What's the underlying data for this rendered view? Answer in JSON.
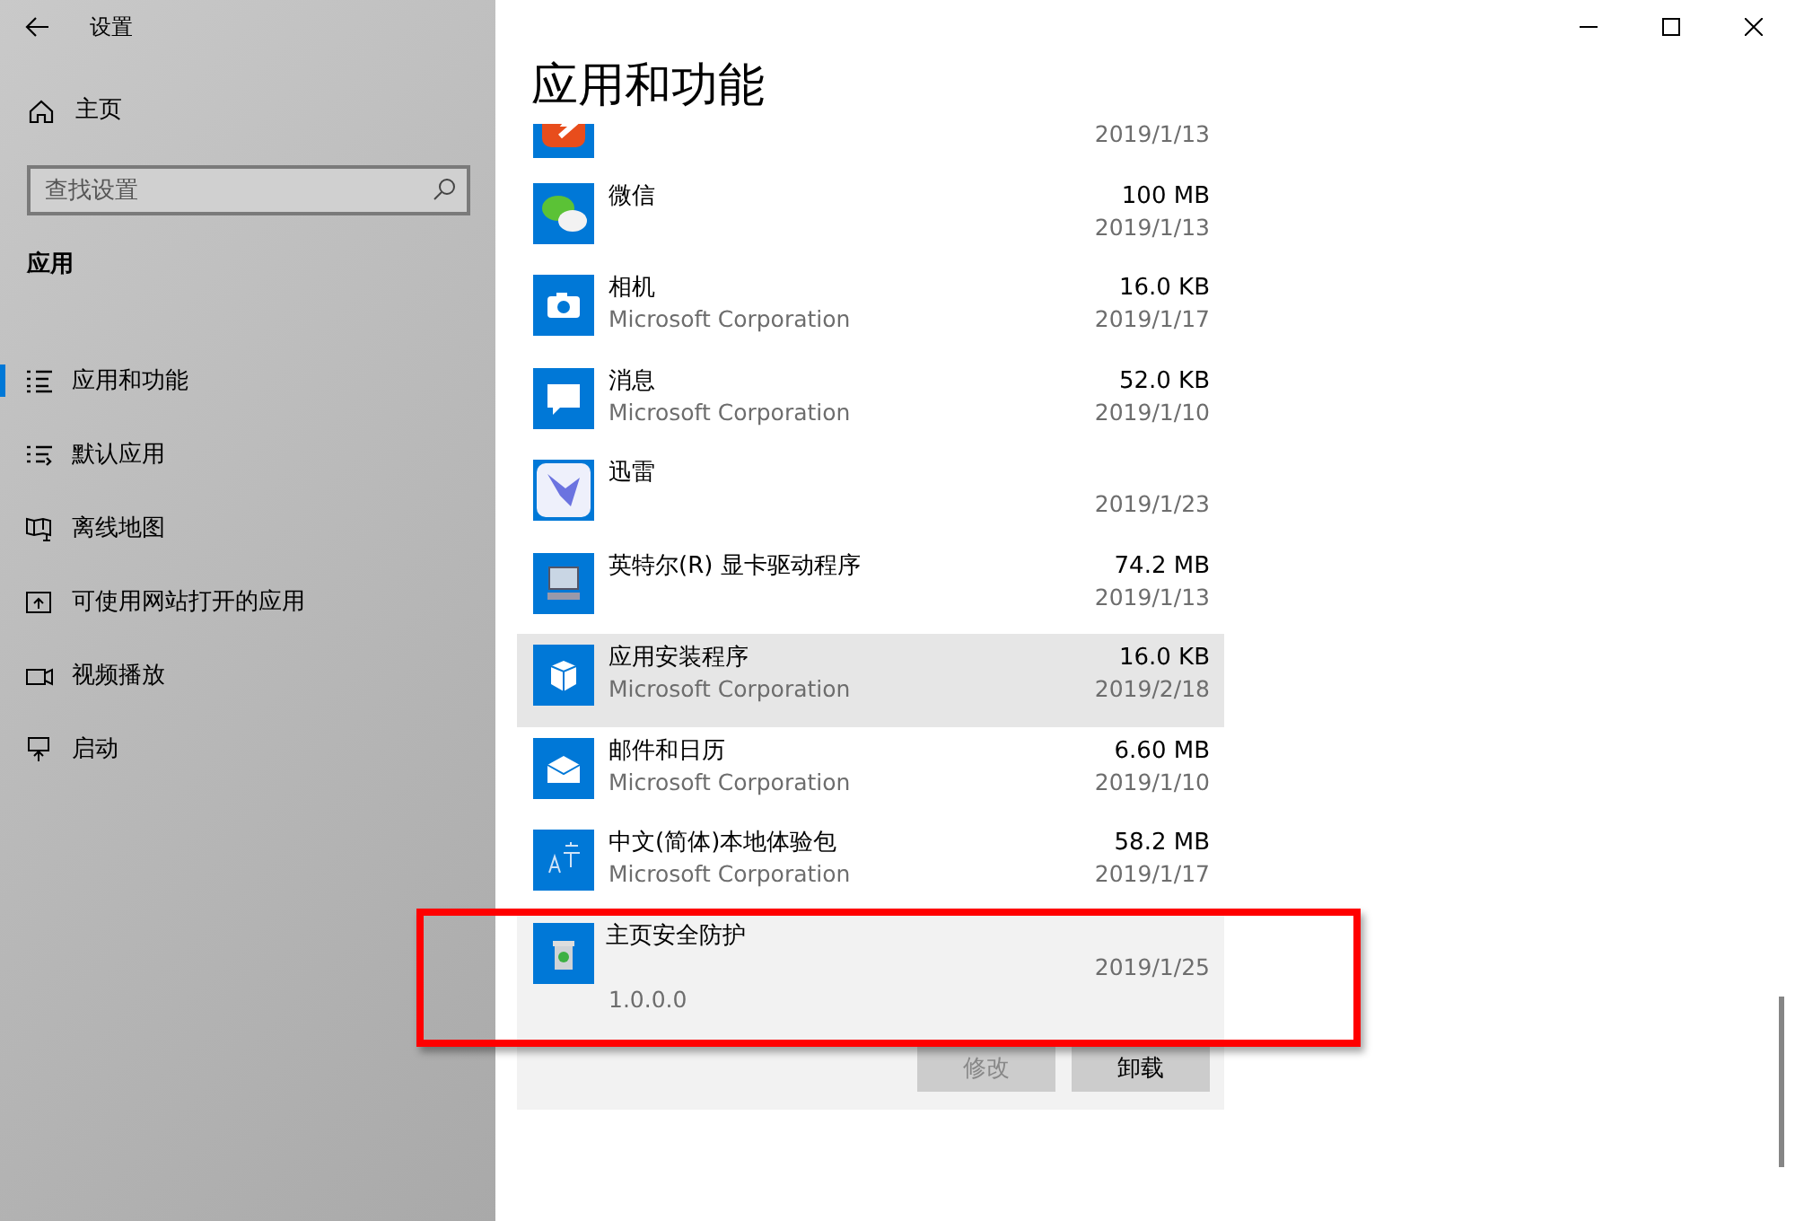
{
  "window": {
    "title": "设置"
  },
  "sidebar": {
    "home": "主页",
    "search": {
      "placeholder": "查找设置"
    },
    "section": "应用",
    "items": [
      {
        "label": "应用和功能",
        "selected": true
      },
      {
        "label": "默认应用",
        "selected": false
      },
      {
        "label": "离线地图",
        "selected": false
      },
      {
        "label": "可使用网站打开的应用",
        "selected": false
      },
      {
        "label": "视频播放",
        "selected": false
      },
      {
        "label": "启动",
        "selected": false
      }
    ]
  },
  "main": {
    "title": "应用和功能",
    "apps": [
      {
        "date": "2019/1/13",
        "hovered": false,
        "selected": false,
        "highlighted": false
      },
      {
        "name": "微信",
        "size": "100 MB",
        "date": "2019/1/13",
        "hovered": false,
        "selected": false,
        "highlighted": false
      },
      {
        "name": "相机",
        "publisher": "Microsoft Corporation",
        "size": "16.0 KB",
        "date": "2019/1/17",
        "hovered": false,
        "selected": false,
        "highlighted": false
      },
      {
        "name": "消息",
        "publisher": "Microsoft Corporation",
        "size": "52.0 KB",
        "date": "2019/1/10",
        "hovered": false,
        "selected": false,
        "highlighted": false
      },
      {
        "name": "迅雷",
        "date": "2019/1/23",
        "hovered": false,
        "selected": false,
        "highlighted": false
      },
      {
        "name": "英特尔(R) 显卡驱动程序",
        "size": "74.2 MB",
        "date": "2019/1/13",
        "hovered": false,
        "selected": false,
        "highlighted": false
      },
      {
        "name": "应用安装程序",
        "publisher": "Microsoft Corporation",
        "size": "16.0 KB",
        "date": "2019/2/18",
        "hovered": true,
        "selected": false,
        "highlighted": false
      },
      {
        "name": "邮件和日历",
        "publisher": "Microsoft Corporation",
        "size": "6.60 MB",
        "date": "2019/1/10",
        "hovered": false,
        "selected": false,
        "highlighted": false
      },
      {
        "name": "中文(简体)本地体验包",
        "publisher": "Microsoft Corporation",
        "size": "58.2 MB",
        "date": "2019/1/17",
        "hovered": false,
        "selected": false,
        "highlighted": false
      },
      {
        "name": "主页安全防护",
        "date": "2019/1/25",
        "version": "1.0.0.0",
        "hovered": false,
        "selected": true,
        "highlighted": true,
        "buttons": [
          {
            "label": "修改",
            "disabled": true
          },
          {
            "label": "卸载",
            "disabled": false
          }
        ]
      }
    ]
  }
}
